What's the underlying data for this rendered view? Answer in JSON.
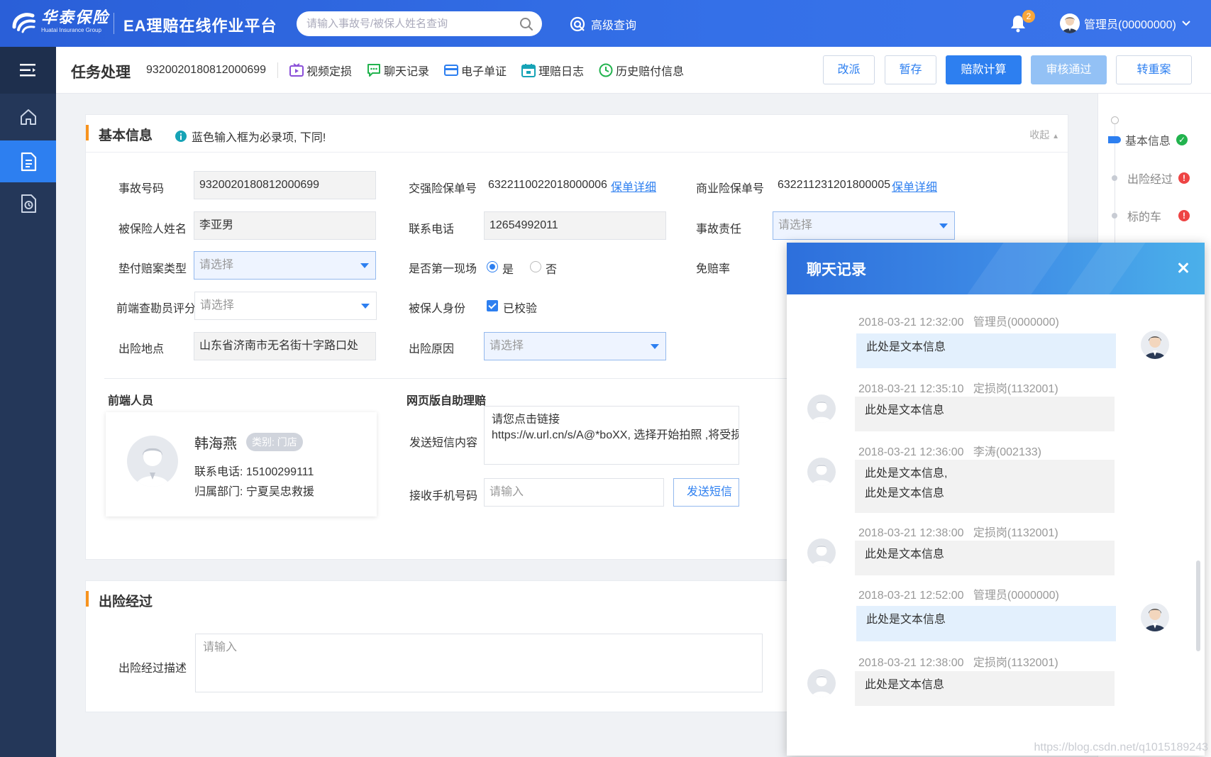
{
  "app": {
    "logo_cn": "华泰保险",
    "logo_en": "Huatai Insurance Group",
    "title": "EA理赔在线作业平台"
  },
  "search": {
    "placeholder": "请输入事故号/被保人姓名查询"
  },
  "advanced_query": {
    "label": "高级查询"
  },
  "notifications": {
    "count": "2"
  },
  "user": {
    "name": "管理员(00000000)"
  },
  "sidebar": {
    "items": [
      {
        "name": "home",
        "active": false
      },
      {
        "name": "document",
        "active": true
      },
      {
        "name": "history",
        "active": false
      }
    ]
  },
  "task": {
    "title": "任务处理",
    "number": "9320020180812000699",
    "links": [
      {
        "label": "视频定损",
        "icon": "video-icon",
        "color": "#8a4fd8"
      },
      {
        "label": "聊天记录",
        "icon": "chat-icon",
        "color": "#22b34e"
      },
      {
        "label": "电子单证",
        "icon": "card-icon",
        "color": "#2d7ff0"
      },
      {
        "label": "理赔日志",
        "icon": "calendar-icon",
        "color": "#16a3b6"
      },
      {
        "label": "历史赔付信息",
        "icon": "clock-icon",
        "color": "#22b34e"
      }
    ],
    "buttons": {
      "reassign": "改派",
      "save_draft": "暂存",
      "calculate": "赔款计算",
      "approve": "审核通过",
      "reopen": "转重案"
    }
  },
  "basic_info": {
    "title": "基本信息",
    "tip": "蓝色输入框为必录项, 下同!",
    "collapse": "收起",
    "accident_no_label": "事故号码",
    "accident_no": "9320020180812000699",
    "compulsory_policy_label": "交强险保单号",
    "compulsory_policy": "6322110022018000006",
    "policy_detail_link": "保单详细",
    "commercial_policy_label": "商业险保单号",
    "commercial_policy": "632211231201800005",
    "insured_name_label": "被保险人姓名",
    "insured_name": "李亚男",
    "phone_label": "联系电话",
    "phone": "12654992011",
    "liability_label": "事故责任",
    "select_placeholder": "请选择",
    "advance_type_label": "垫付赔案类型",
    "first_scene_label": "是否第一现场",
    "first_scene_yes": "是",
    "first_scene_no": "否",
    "deductible_label": "免赔率",
    "surveyor_rating_label": "前端查勘员评分",
    "insured_identity_label": "被保人身份",
    "verified_label": "已校验",
    "location_label": "出险地点",
    "location": "山东省济南市无名街十字路口处",
    "cause_label": "出险原因"
  },
  "frontend_staff": {
    "title": "前端人员",
    "name": "韩海燕",
    "tag": "类别: 门店",
    "phone_line": "联系电话: 15100299111",
    "dept_line": "归属部门: 宁夏吴忠救援"
  },
  "self_service": {
    "title": "网页版自助理赔",
    "sms_label": "发送短信内容",
    "sms_line1": "请您点击链接",
    "sms_line2": "https://w.url.cn/s/A@*boXX, 选择开始拍照 ,将受损",
    "receiver_label": "接收手机号码",
    "receiver_placeholder": "请输入",
    "send_button": "发送短信"
  },
  "accident_process": {
    "title": "出险经过",
    "desc_label": "出险经过描述",
    "desc_placeholder": "请输入"
  },
  "timeline": {
    "items": [
      {
        "label": "基本信息",
        "status": "ok",
        "current": true
      },
      {
        "label": "出险经过",
        "status": "error",
        "current": false
      },
      {
        "label": "标的车",
        "status": "error",
        "current": false
      }
    ]
  },
  "chat": {
    "title": "聊天记录",
    "messages": [
      {
        "time": "2018-03-21 12:32:00",
        "sender": "管理员(0000000)",
        "lines": [
          "此处是文本信息"
        ],
        "mine": true
      },
      {
        "time": "2018-03-21 12:35:10",
        "sender": "定损岗(1132001)",
        "lines": [
          "此处是文本信息"
        ],
        "mine": false
      },
      {
        "time": "2018-03-21 12:36:00",
        "sender": "李涛(002133)",
        "lines": [
          "此处是文本信息,",
          "此处是文本信息"
        ],
        "mine": false
      },
      {
        "time": "2018-03-21 12:38:00",
        "sender": "定损岗(1132001)",
        "lines": [
          "此处是文本信息"
        ],
        "mine": false
      },
      {
        "time": "2018-03-21 12:52:00",
        "sender": "管理员(0000000)",
        "lines": [
          "此处是文本信息"
        ],
        "mine": true
      },
      {
        "time": "2018-03-21 12:38:00",
        "sender": "定损岗(1132001)",
        "lines": [
          "此处是文本信息"
        ],
        "mine": false
      }
    ]
  },
  "watermark": "https://blog.csdn.net/q1015189243",
  "colors": {
    "primary": "#2d7ff0",
    "header": "#3470e8",
    "sidebar": "#243759",
    "accent": "#f7931e"
  }
}
